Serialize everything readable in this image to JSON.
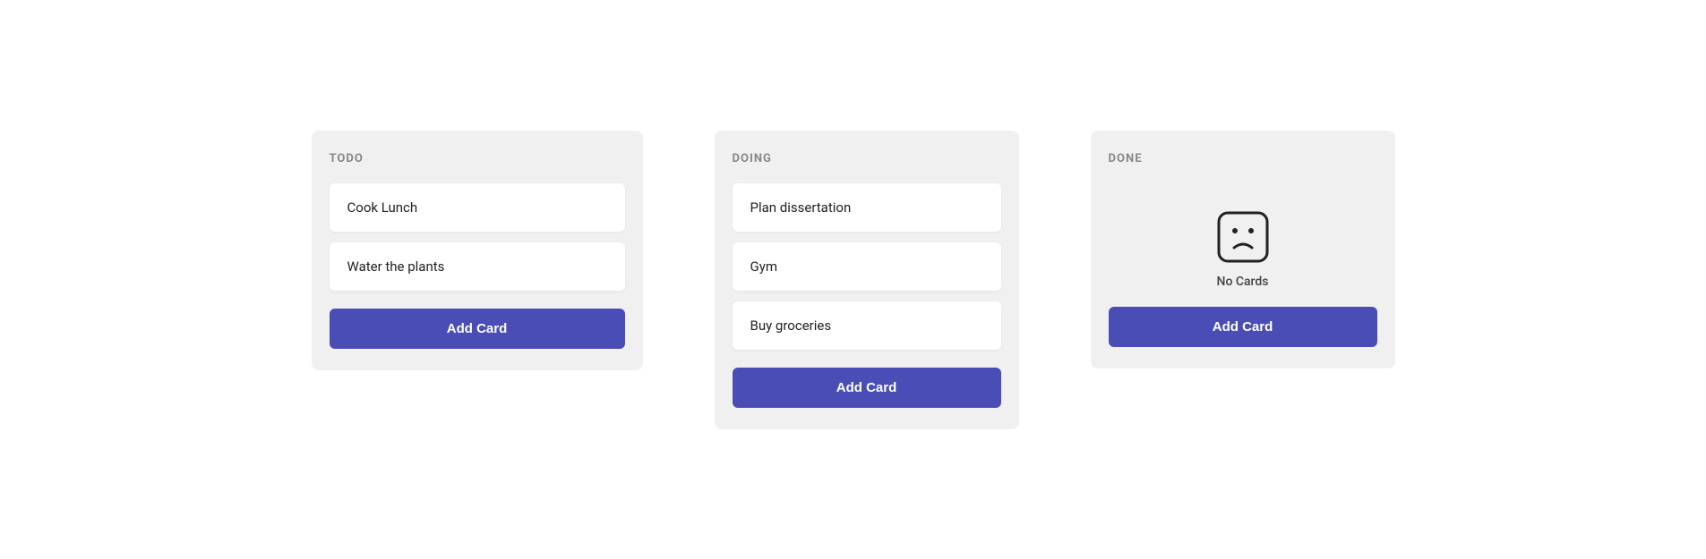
{
  "columns": [
    {
      "id": "todo",
      "header": "TODO",
      "cards": [
        {
          "id": "card-1",
          "text": "Cook Lunch"
        },
        {
          "id": "card-2",
          "text": "Water the plants"
        }
      ],
      "add_button_label": "Add Card",
      "has_empty_state": false
    },
    {
      "id": "doing",
      "header": "DOING",
      "cards": [
        {
          "id": "card-3",
          "text": "Plan dissertation"
        },
        {
          "id": "card-4",
          "text": "Gym"
        },
        {
          "id": "card-5",
          "text": "Buy groceries"
        }
      ],
      "add_button_label": "Add Card",
      "has_empty_state": false
    },
    {
      "id": "done",
      "header": "DONE",
      "cards": [],
      "add_button_label": "Add Card",
      "has_empty_state": true,
      "empty_state_text": "No Cards"
    }
  ]
}
